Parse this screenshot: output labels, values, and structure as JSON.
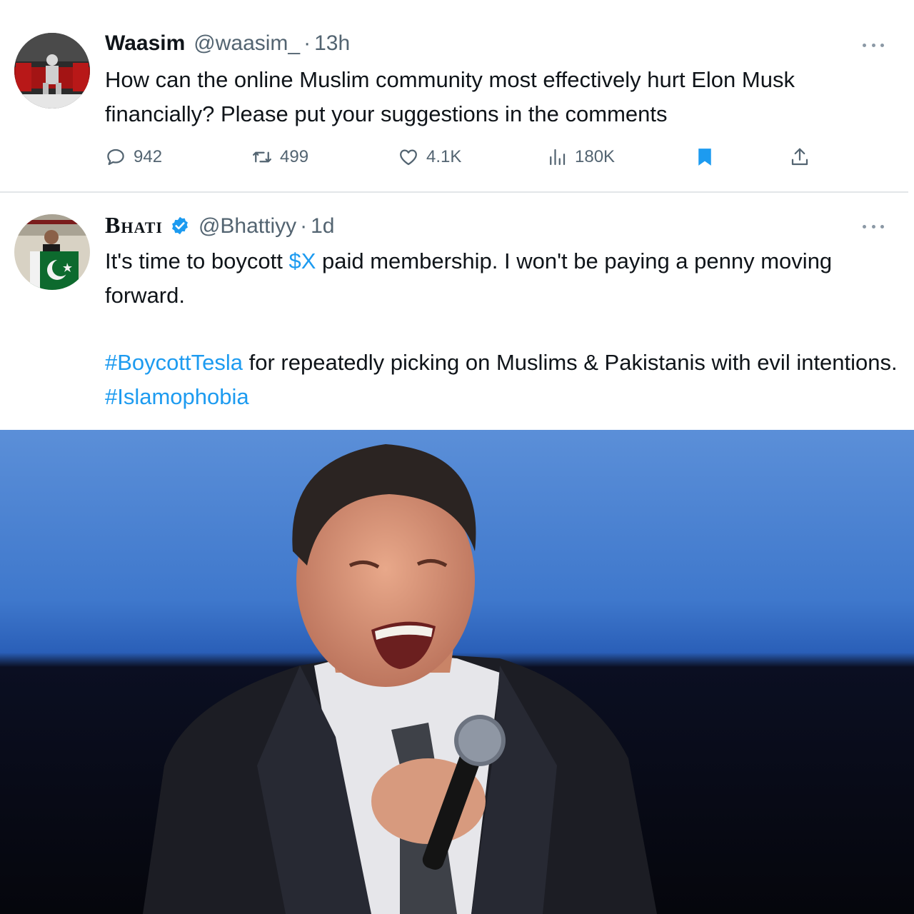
{
  "tweets": [
    {
      "name": "Waasim",
      "handle": "@waasim_",
      "separator": "·",
      "time": "13h",
      "text": "How can the online Muslim community most effectively hurt Elon Musk financially? Please put your suggestions in the comments",
      "replies": "942",
      "retweets": "499",
      "likes": "4.1K",
      "views": "180K"
    },
    {
      "name": "Bhati",
      "handle": "@Bhattiyy",
      "separator": "·",
      "time": "1d",
      "text_p1_before": "It's time to boycott ",
      "text_p1_cashtag": "$X",
      "text_p1_after": " paid membership. I won't be paying a penny moving forward.",
      "text_p2_hashtag1": "#BoycottTesla",
      "text_p2_middle": " for repeatedly picking on Muslims & Pakistanis with evil intentions. ",
      "text_p2_hashtag2": "#Islamophobia"
    }
  ],
  "icons": {
    "reply": "speech-bubble-icon",
    "retweet": "retweet-arrows-icon",
    "like": "heart-icon",
    "views": "bar-chart-icon",
    "bookmark": "bookmark-icon",
    "share": "share-upload-icon",
    "more": "more-dots-icon",
    "verified": "verified-badge-icon"
  },
  "colors": {
    "link": "#1d9bf0",
    "muted": "#536471",
    "bookmark_active": "#1d9bf0",
    "verified": "#1d9bf0"
  }
}
